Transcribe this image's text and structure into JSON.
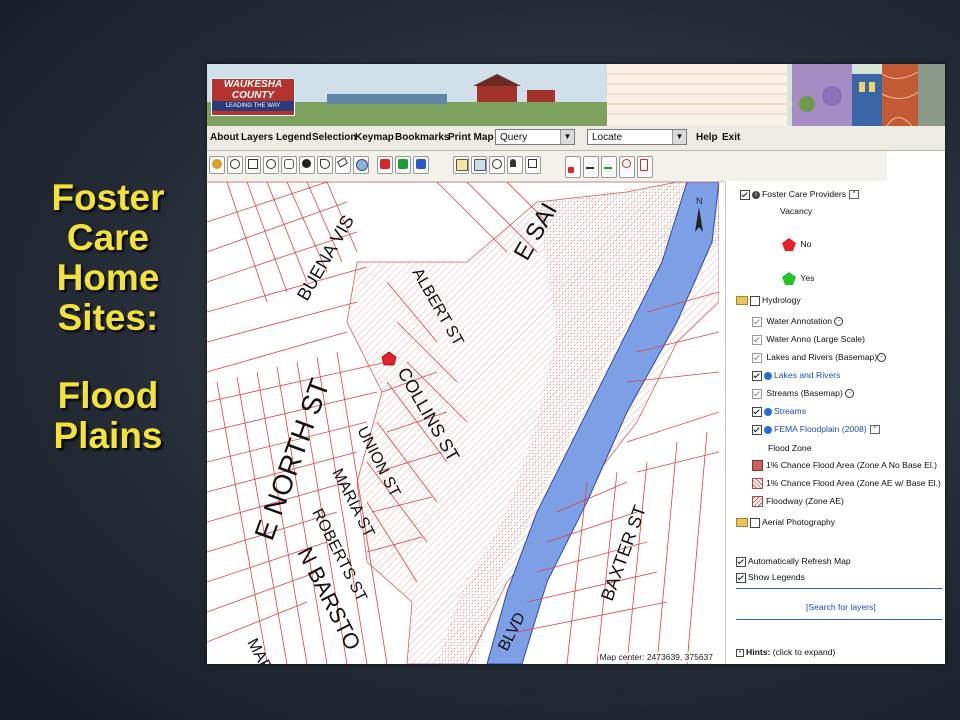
{
  "slide": {
    "title_lines": [
      "Foster",
      "Care",
      "Home",
      "Sites:"
    ],
    "subtitle_lines": [
      "Flood",
      "Plains"
    ]
  },
  "banner": {
    "logo_line1": "WAUKESHA",
    "logo_line2": "COUNTY",
    "tagline": "LEADING THE WAY"
  },
  "menu": {
    "items": [
      "About",
      "Layers",
      "Legend",
      "Selection",
      "Keymap",
      "Bookmarks",
      "Print Map"
    ],
    "query_select": "Query",
    "locate_select": "Locate",
    "help": "Help",
    "exit": "Exit"
  },
  "toolbar": {
    "tools": [
      "zoom-in-icon",
      "zoom-out-icon",
      "full-extent-icon",
      "zoom-prev-icon",
      "pan-icon",
      "identify-icon",
      "measure-icon",
      "eraser-icon",
      "locate-icon",
      "red-cube-icon",
      "green-cube-icon",
      "blue-cube-icon",
      "query-icon",
      "select-icon",
      "info-icon",
      "user-icon",
      "add-icon",
      "page1-icon",
      "page2-icon",
      "page3-icon",
      "page4-icon",
      "page5-icon"
    ]
  },
  "map": {
    "streets": [
      "BUENA VIS",
      "E SAI",
      "ALBERT ST",
      "COLLINS ST",
      "E NORTH ST",
      "UNION ST",
      "MARIA ST",
      "ROBERTS ST",
      "N BARSTO",
      "BAXTER ST",
      "BLVD",
      "MAR"
    ],
    "map_center_label": "Map center: 2473639, 375637",
    "north_arrow": "N"
  },
  "layers": {
    "foster_care": "Foster Care Providers",
    "vacancy": "Vacancy",
    "no": "No",
    "yes": "Yes",
    "hydrology": "Hydrology",
    "water_annotation": "Water Annotation",
    "water_anno_large": "Water Anno (Large Scale)",
    "lakes_rivers_base": "Lakes and Rivers (Basemap)",
    "lakes_rivers": "Lakes and Rivers",
    "streams_base": "Streams (Basemap)",
    "streams": "Streams",
    "fema": "FEMA Floodplain (2008)",
    "flood_zone": "Flood Zone",
    "zone_a": "1% Chance Flood Area (Zone A No Base El.)",
    "zone_ae": "1% Chance Flood Area (Zone AE w/ Base El.)",
    "floodway": "Floodway (Zone AE)",
    "aerial": "Aerial Photography",
    "auto_refresh": "Automatically Refresh Map",
    "show_legends": "Show Legends",
    "search_layers": "[Search for layers]",
    "hints_label": "Hints:",
    "hints_action": "(click to expand)"
  },
  "colors": {
    "slide_title": "#f2e23a",
    "river": "#7d9fe6",
    "parcel_line": "#e04040",
    "floodplain_hatch": "#e39a9a",
    "no_marker": "#e8202a",
    "yes_marker": "#22c42a"
  }
}
